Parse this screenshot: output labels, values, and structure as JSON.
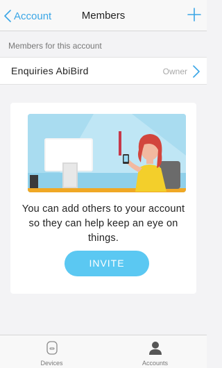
{
  "nav": {
    "back_label": "Account",
    "title": "Members",
    "add_icon": "plus-icon",
    "accent_color": "#3aa6e6"
  },
  "members": {
    "section_header": "Members for this account",
    "rows": [
      {
        "name": "Enquiries AbiBird",
        "role": "Owner"
      }
    ]
  },
  "invite_card": {
    "illustration": "person-with-phone-illustration",
    "text": "You can add others to your account so they can help keep an eye on things.",
    "button_label": "INVITE",
    "button_color": "#5bc8f2"
  },
  "tabbar": {
    "tabs": [
      {
        "label": "Devices",
        "icon": "device-icon"
      },
      {
        "label": "Accounts",
        "icon": "person-icon"
      }
    ]
  }
}
